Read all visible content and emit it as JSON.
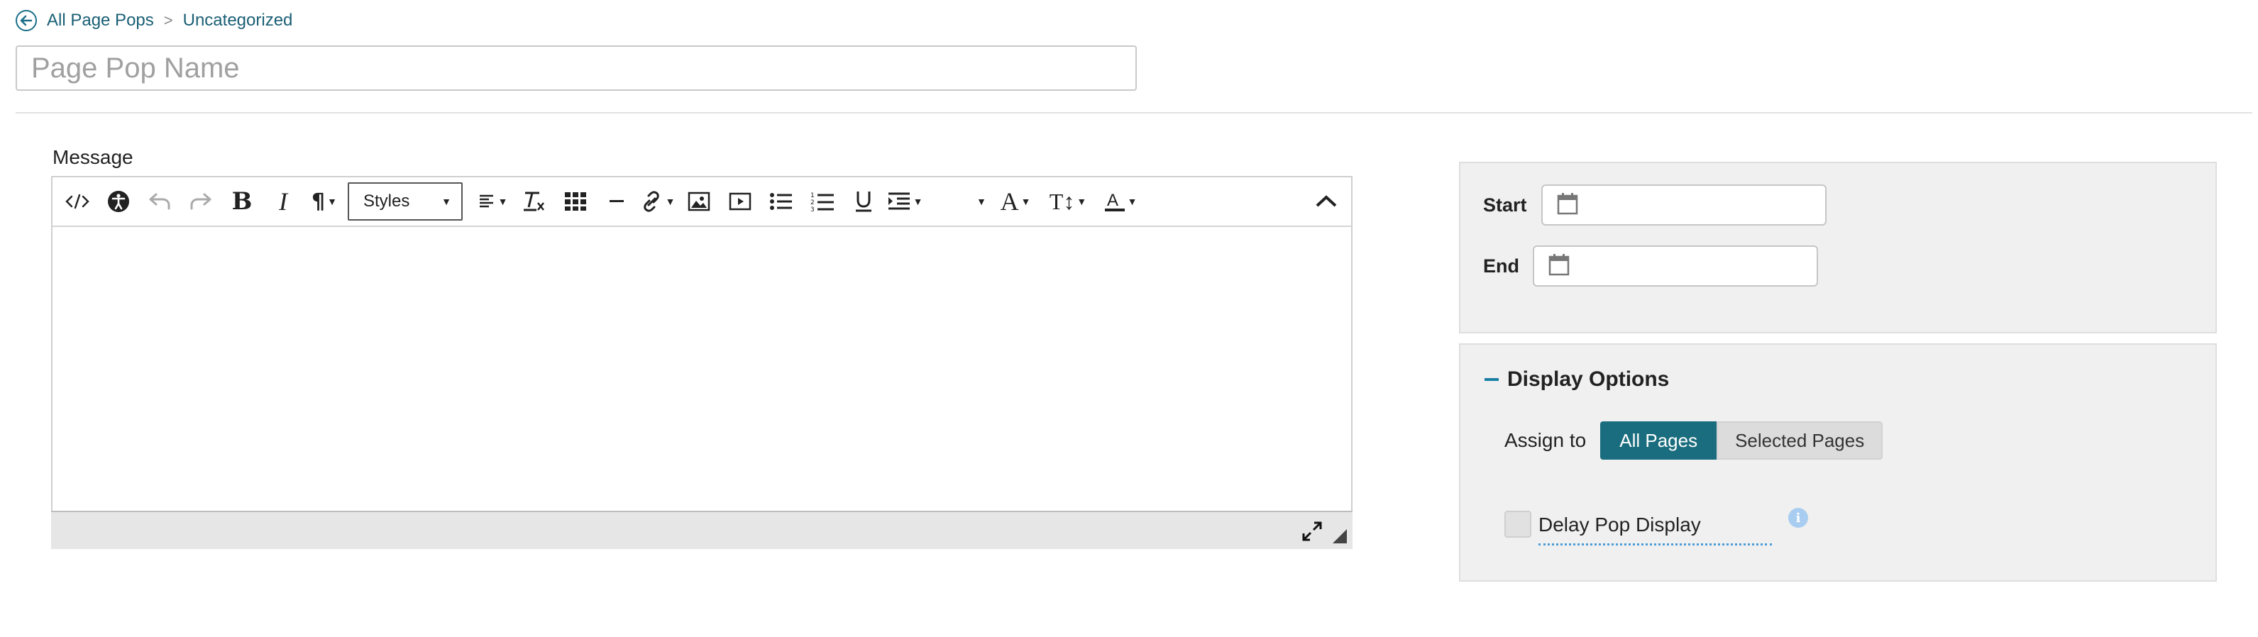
{
  "breadcrumb": {
    "back_label": "All Page Pops",
    "separator": ">",
    "current": "Uncategorized"
  },
  "name_field": {
    "value": "",
    "placeholder": "Page Pop Name"
  },
  "message": {
    "label": "Message"
  },
  "toolbar": {
    "styles_label": "Styles",
    "buttons": [
      "source-code",
      "accessibility",
      "undo",
      "redo",
      "bold",
      "italic",
      "paragraph",
      "styles",
      "align",
      "clear-formatting",
      "table",
      "horizontal-rule",
      "link",
      "image",
      "media",
      "bulleted-list",
      "numbered-list",
      "underline",
      "indent",
      "more",
      "font-family",
      "font-size",
      "text-color",
      "collapse"
    ]
  },
  "dates": {
    "start_label": "Start",
    "end_label": "End",
    "start_value": "",
    "end_value": ""
  },
  "display_options": {
    "title": "Display Options",
    "assign_label": "Assign to",
    "options": [
      "All Pages",
      "Selected Pages"
    ],
    "selected": "All Pages",
    "delay_label": "Delay Pop Display",
    "delay_checked": false
  },
  "colors": {
    "link": "#1a5f75",
    "accent": "#1a6d7e",
    "panel_bg": "#f0f0f0",
    "info": "#a8cdf0"
  }
}
